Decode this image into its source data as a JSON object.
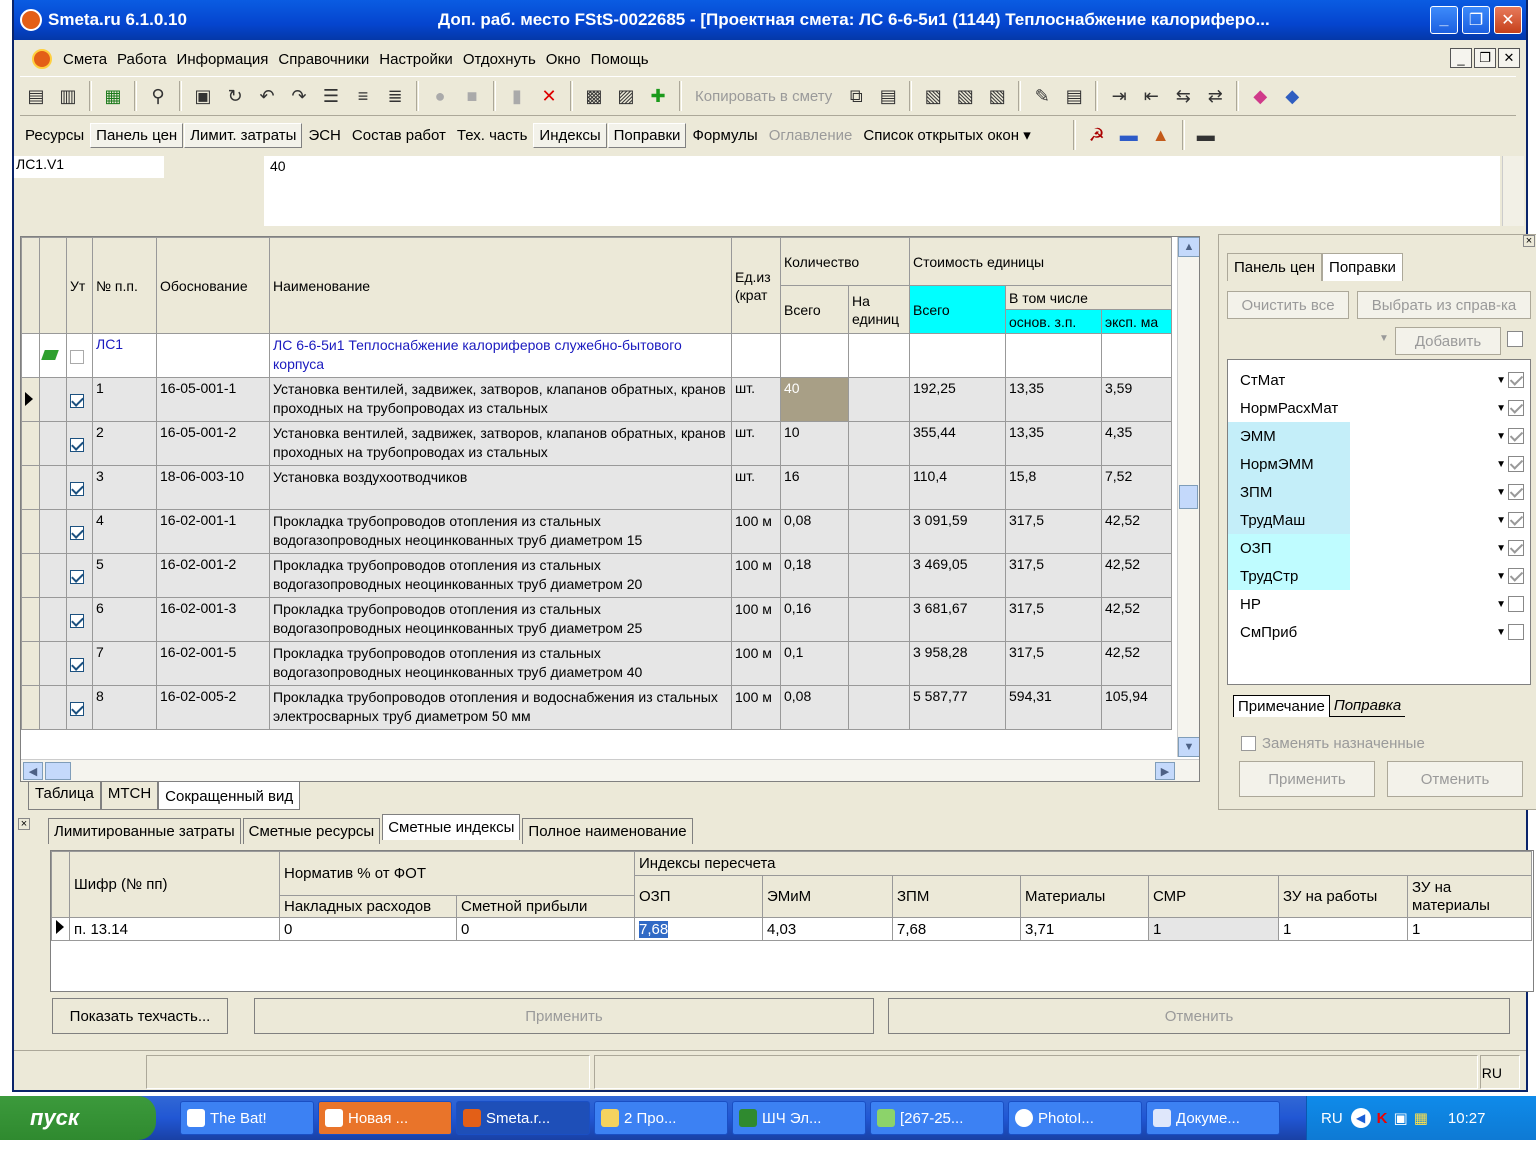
{
  "titlebar": {
    "app": "Smeta.ru  6.1.0.10",
    "doc": "Доп. раб. место  FStS-0022685 - [Проектная смета: ЛС 6-6-5и1 (1144) Теплоснабжение калориферо..."
  },
  "menu": [
    "Смета",
    "Работа",
    "Информация",
    "Справочники",
    "Настройки",
    "Отдохнуть",
    "Окно",
    "Помощь"
  ],
  "toolbar1": {
    "copy_label": "Копировать в смету"
  },
  "toolbar2": [
    "Ресурсы",
    "Панель цен",
    "Лимит. затраты",
    "ЭСН",
    "Состав работ",
    "Тех. часть",
    "Индексы",
    "Поправки",
    "Формулы",
    "Оглавление",
    "Список открытых окон ▾"
  ],
  "formula": {
    "cellref": "ЛС1.V1",
    "value": "40"
  },
  "grid": {
    "headers": {
      "ut": "Ут",
      "num": "№ п.п.",
      "basis": "Обоснование",
      "name": "Наименование",
      "unit": "Ед.из (крат",
      "qty": "Количество",
      "qty_total": "Всего",
      "qty_per": "На единиц",
      "cost": "Стоимость единицы",
      "cost_total": "Всего",
      "incl": "В том числе",
      "osn": "основ. з.п.",
      "eksp": "эксп. ма"
    },
    "ls": {
      "num": "ЛС1",
      "name": "ЛС 6-6-5и1 Теплоснабжение калориферов служебно-бытового корпуса"
    },
    "rows": [
      {
        "num": "1",
        "basis": "16-05-001-1",
        "name": "Установка вентилей, задвижек, затворов, клапанов обратных, кранов проходных на трубопроводах из стальных",
        "unit": "шт.",
        "qty": "40",
        "total": "192,25",
        "osn": "13,35",
        "eksp": "3,59"
      },
      {
        "num": "2",
        "basis": "16-05-001-2",
        "name": "Установка вентилей, задвижек, затворов, клапанов обратных, кранов проходных на трубопроводах из стальных",
        "unit": "шт.",
        "qty": "10",
        "total": "355,44",
        "osn": "13,35",
        "eksp": "4,35"
      },
      {
        "num": "3",
        "basis": "18-06-003-10",
        "name": "Установка воздухоотводчиков",
        "unit": "шт.",
        "qty": "16",
        "total": "110,4",
        "osn": "15,8",
        "eksp": "7,52"
      },
      {
        "num": "4",
        "basis": "16-02-001-1",
        "name": "Прокладка трубопроводов отопления из стальных водогазопроводных неоцинкованных труб диаметром 15",
        "unit": "100 м",
        "qty": "0,08",
        "total": "3 091,59",
        "osn": "317,5",
        "eksp": "42,52"
      },
      {
        "num": "5",
        "basis": "16-02-001-2",
        "name": "Прокладка трубопроводов отопления из стальных водогазопроводных неоцинкованных труб диаметром 20",
        "unit": "100 м",
        "qty": "0,18",
        "total": "3 469,05",
        "osn": "317,5",
        "eksp": "42,52"
      },
      {
        "num": "6",
        "basis": "16-02-001-3",
        "name": "Прокладка трубопроводов отопления из стальных водогазопроводных неоцинкованных труб диаметром 25",
        "unit": "100 м",
        "qty": "0,16",
        "total": "3 681,67",
        "osn": "317,5",
        "eksp": "42,52"
      },
      {
        "num": "7",
        "basis": "16-02-001-5",
        "name": "Прокладка трубопроводов отопления из стальных водогазопроводных неоцинкованных труб диаметром 40",
        "unit": "100 м",
        "qty": "0,1",
        "total": "3 958,28",
        "osn": "317,5",
        "eksp": "42,52"
      },
      {
        "num": "8",
        "basis": "16-02-005-2",
        "name": "Прокладка трубопроводов отопления и водоснабжения из стальных электросварных труб диаметром 50 мм",
        "unit": "100 м",
        "qty": "0,08",
        "total": "5 587,77",
        "osn": "594,31",
        "eksp": "105,94"
      }
    ],
    "tabs": [
      "Таблица",
      "МТСН",
      "Сокращенный вид"
    ]
  },
  "right": {
    "tabs": [
      "Панель цен",
      "Поправки"
    ],
    "clear_all": "Очистить все",
    "choose": "Выбрать из справ-ка",
    "add": "Добавить",
    "items": [
      {
        "label": "СтМат",
        "checked": true,
        "tone": ""
      },
      {
        "label": "НормРасхМат",
        "checked": true,
        "tone": ""
      },
      {
        "label": "ЭММ",
        "checked": true,
        "tone": "c1"
      },
      {
        "label": "НормЭММ",
        "checked": true,
        "tone": "c1"
      },
      {
        "label": "ЗПМ",
        "checked": true,
        "tone": "c1"
      },
      {
        "label": "ТрудМаш",
        "checked": true,
        "tone": "c1"
      },
      {
        "label": "ОЗП",
        "checked": true,
        "tone": "c2"
      },
      {
        "label": "ТрудСтр",
        "checked": true,
        "tone": "c2"
      },
      {
        "label": "НР",
        "checked": false,
        "tone": ""
      },
      {
        "label": "СмПриб",
        "checked": false,
        "tone": ""
      }
    ],
    "subtabs": [
      "Примечание",
      "Поправка"
    ],
    "replace": "Заменять назначенные",
    "apply": "Применить",
    "cancel": "Отменить"
  },
  "bottom": {
    "tabs": [
      "Лимитированные затраты",
      "Сметные ресурсы",
      "Сметные индексы",
      "Полное наименование"
    ],
    "headers": {
      "cipher": "Шифр (№ пп)",
      "norm": "Норматив % от ФОТ",
      "overhead": "Накладных расходов",
      "profit": "Сметной прибыли",
      "idx": "Индексы пересчета",
      "ozp": "ОЗП",
      "emim": "ЭМиМ",
      "zpm": "ЗПМ",
      "mat": "Материалы",
      "smr": "СМР",
      "zu_work": "ЗУ на работы",
      "zu_mat": "ЗУ на материалы"
    },
    "row": {
      "cipher": "п. 13.14",
      "overhead": "0",
      "profit": "0",
      "ozp": "7,68",
      "emim": "4,03",
      "zpm": "7,68",
      "mat": "3,71",
      "smr": "1",
      "zu_work": "1",
      "zu_mat": "1"
    },
    "show_tech": "Показать техчасть...",
    "apply": "Применить",
    "cancel": "Отменить"
  },
  "status": {
    "lang": "RU"
  },
  "taskbar": {
    "start": "пуск",
    "tasks": [
      "The Bat!",
      "Новая ...",
      "Smeta.r...",
      "2 Про...",
      "ШЧ Эл...",
      "[267-25...",
      "PhotoI...",
      "Докуме..."
    ],
    "lang": "RU",
    "clock": "10:27"
  }
}
